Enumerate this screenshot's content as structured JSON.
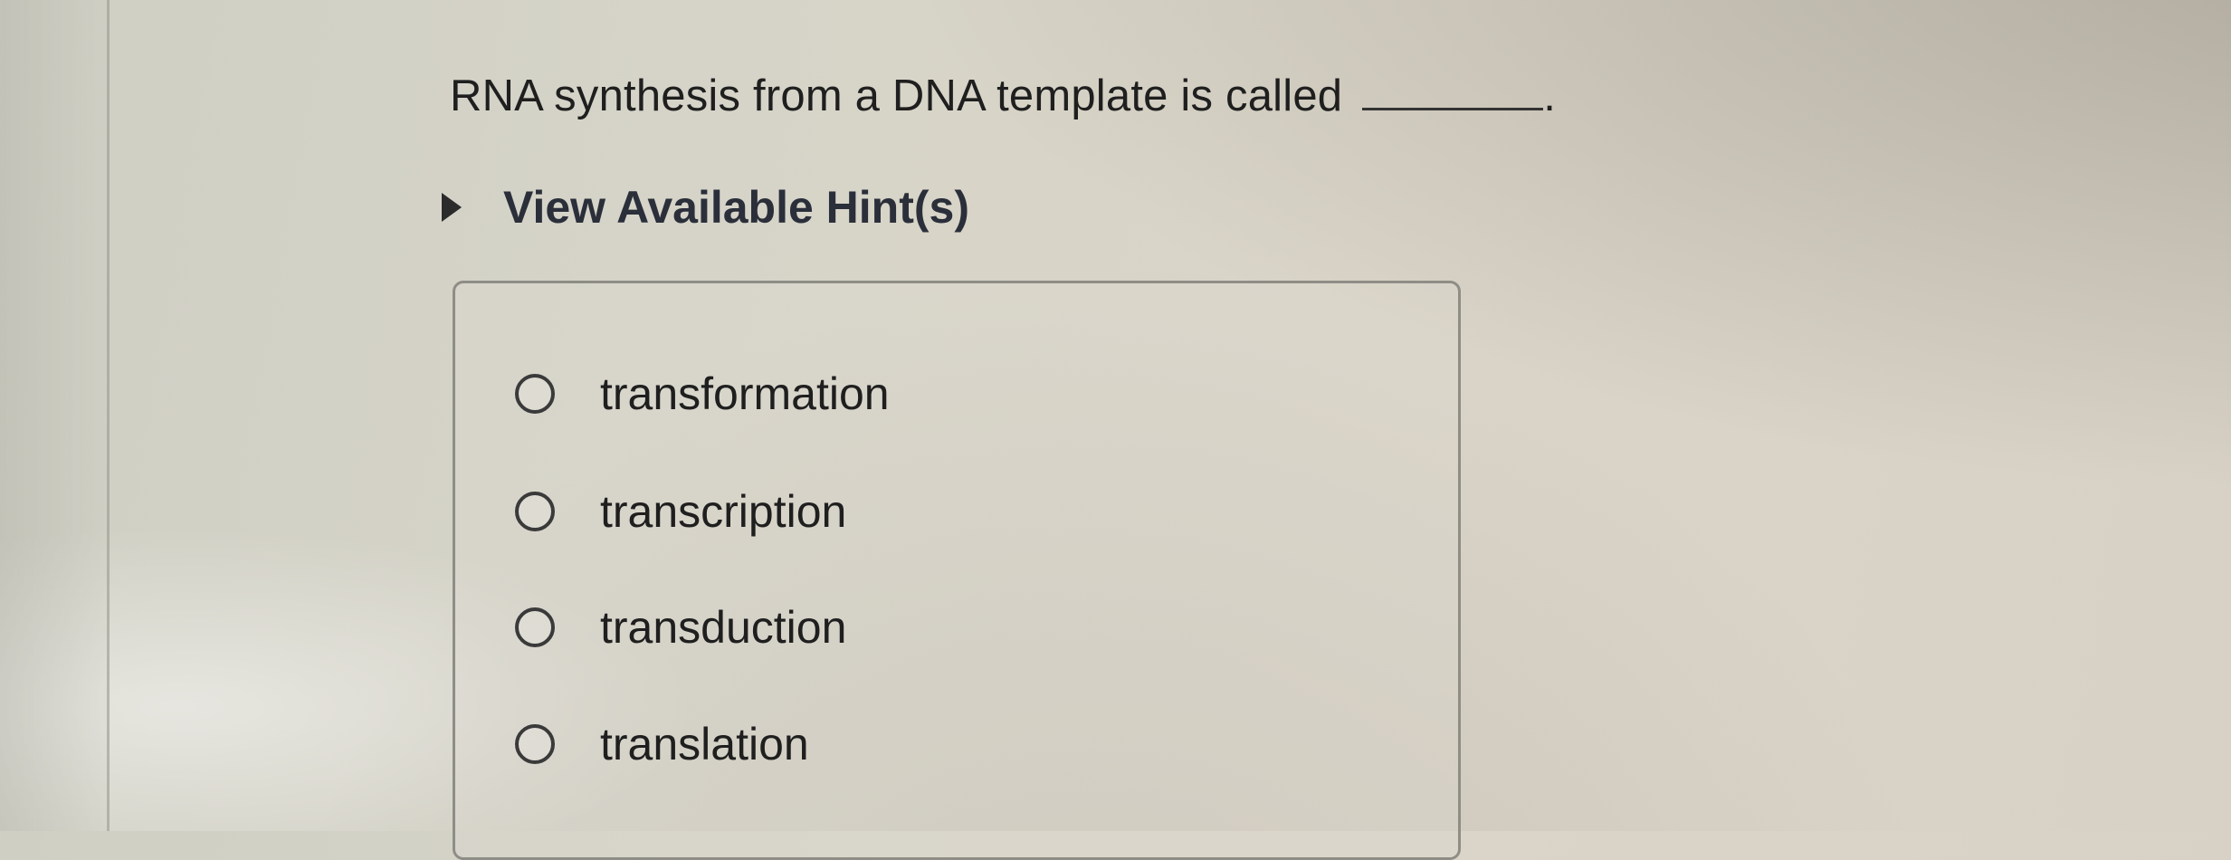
{
  "question": {
    "text": "RNA synthesis from a DNA template is called",
    "end_punct": "."
  },
  "hint": {
    "label": "View Available Hint(s)"
  },
  "options": [
    {
      "label": "transformation"
    },
    {
      "label": "transcription"
    },
    {
      "label": "transduction"
    },
    {
      "label": "translation"
    }
  ]
}
